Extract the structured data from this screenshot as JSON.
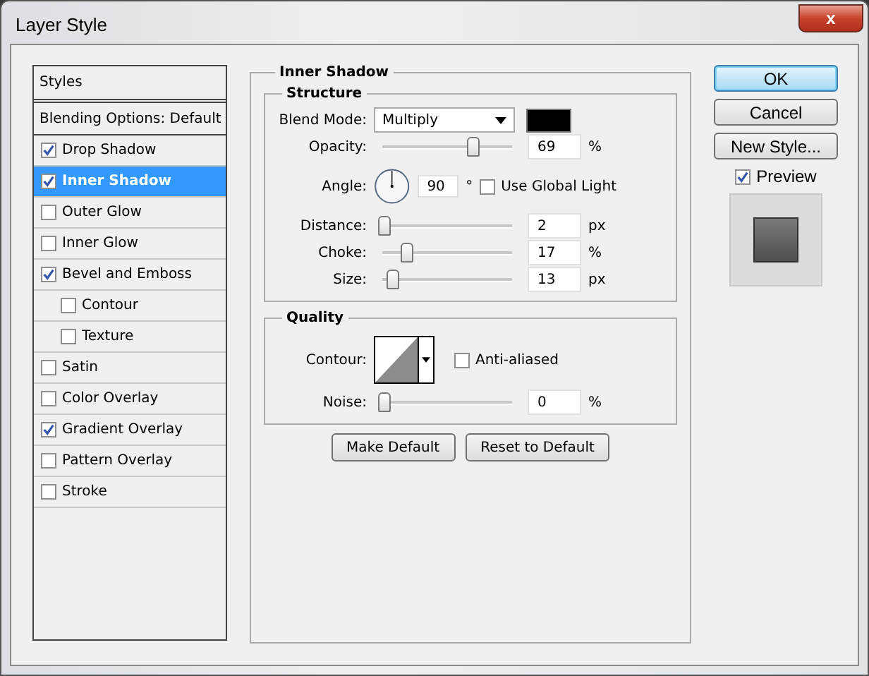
{
  "window": {
    "title": "Layer Style",
    "close_label": "x"
  },
  "styles_panel": {
    "header": "Styles",
    "items": [
      {
        "kind": "header",
        "label": "Blending Options: Default",
        "selected": false
      },
      {
        "kind": "option",
        "label": "Drop Shadow",
        "checked": true,
        "selected": false
      },
      {
        "kind": "option",
        "label": "Inner Shadow",
        "checked": true,
        "selected": true
      },
      {
        "kind": "option",
        "label": "Outer Glow",
        "checked": false,
        "selected": false
      },
      {
        "kind": "option",
        "label": "Inner Glow",
        "checked": false,
        "selected": false
      },
      {
        "kind": "option",
        "label": "Bevel and Emboss",
        "checked": true,
        "selected": false,
        "children": [
          {
            "kind": "option",
            "label": "Contour",
            "checked": false,
            "selected": false
          },
          {
            "kind": "option",
            "label": "Texture",
            "checked": false,
            "selected": false
          }
        ]
      },
      {
        "kind": "option",
        "label": "Satin",
        "checked": false,
        "selected": false
      },
      {
        "kind": "option",
        "label": "Color Overlay",
        "checked": false,
        "selected": false
      },
      {
        "kind": "option",
        "label": "Gradient Overlay",
        "checked": true,
        "selected": false
      },
      {
        "kind": "option",
        "label": "Pattern Overlay",
        "checked": false,
        "selected": false
      },
      {
        "kind": "option",
        "label": "Stroke",
        "checked": false,
        "selected": false
      }
    ]
  },
  "inner_shadow": {
    "title": "Inner Shadow",
    "structure": {
      "title": "Structure",
      "blend_mode": {
        "label": "Blend Mode:",
        "value": "Multiply"
      },
      "opacity": {
        "label": "Opacity:",
        "level": 0.69,
        "value": "69",
        "unit": "%"
      },
      "angle": {
        "label": "Angle:",
        "value": "90",
        "unit": "°"
      },
      "use_global_light": {
        "label": "Use Global Light",
        "checked": false
      },
      "sliders": [
        {
          "label": "Distance:",
          "level": 0.0,
          "value": "2",
          "unit": "px"
        },
        {
          "label": "Choke:",
          "level": 0.17,
          "value": "17",
          "unit": "%"
        },
        {
          "label": "Size:",
          "level": 0.06,
          "value": "13",
          "unit": "px"
        }
      ]
    },
    "quality": {
      "title": "Quality",
      "contour": {
        "label": "Contour:"
      },
      "anti_aliased": {
        "label": "Anti-aliased",
        "checked": false
      },
      "noise": {
        "label": "Noise:",
        "level": 0.0,
        "value": "0",
        "unit": "%"
      }
    },
    "buttons": [
      "Make Default",
      "Reset to Default"
    ]
  },
  "actions": {
    "buttons": [
      {
        "label": "OK",
        "kind": "default"
      },
      {
        "label": "Cancel",
        "kind": "normal"
      },
      {
        "label": "New Style...",
        "kind": "normal"
      }
    ],
    "preview": {
      "label": "Preview",
      "checked": true
    }
  }
}
